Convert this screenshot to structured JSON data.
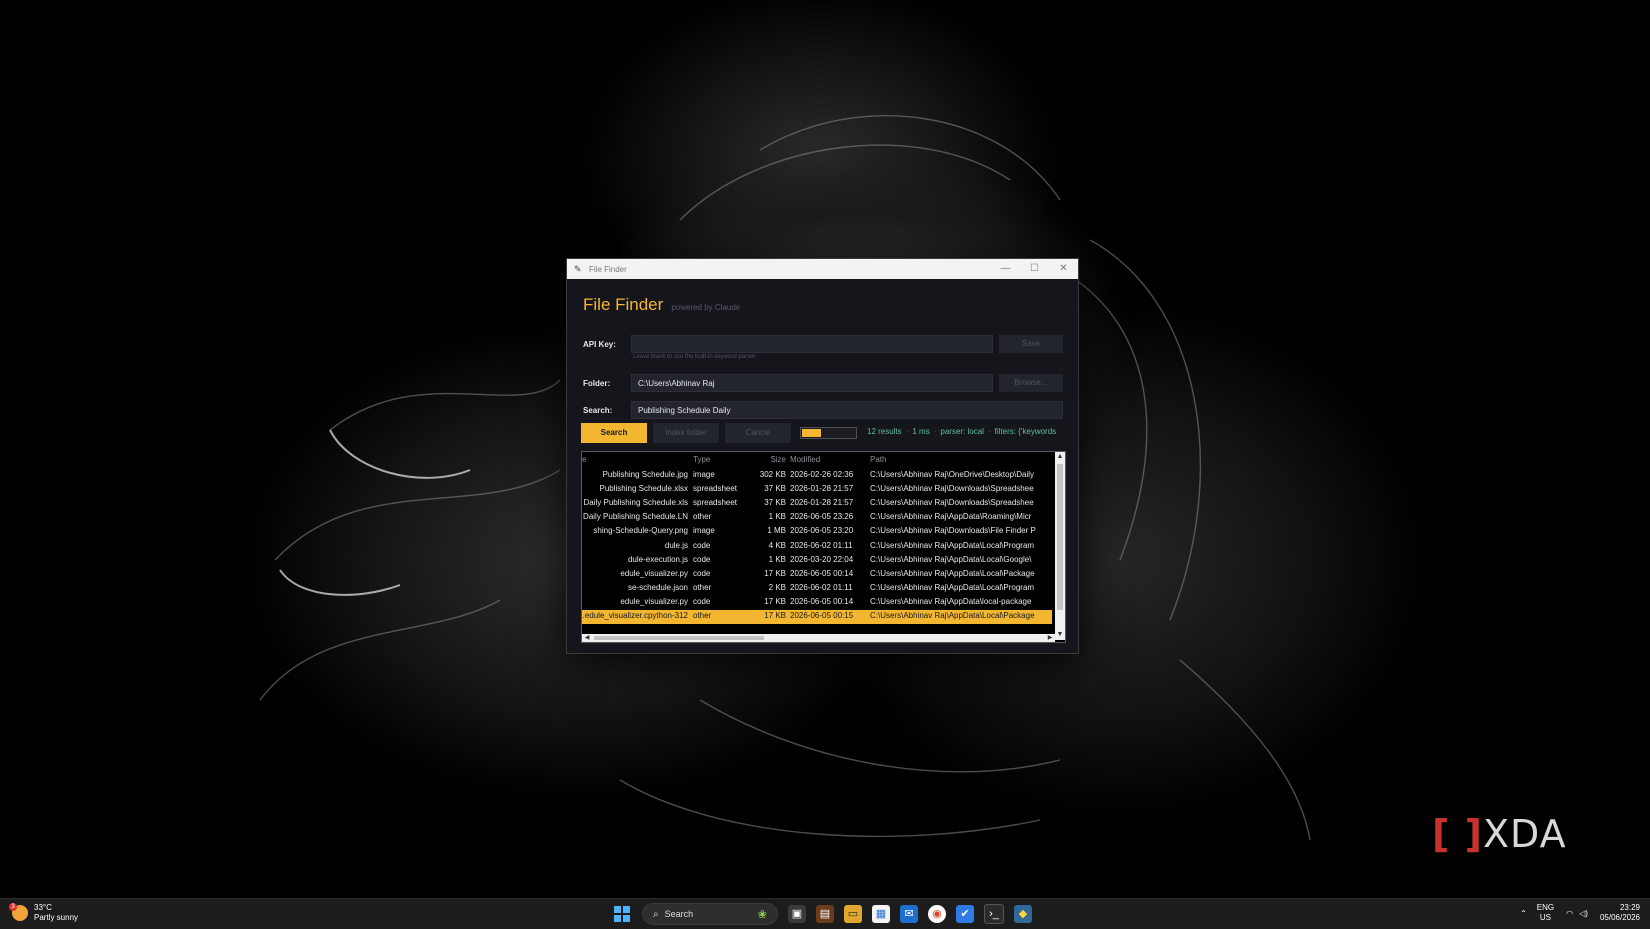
{
  "window": {
    "title": "File Finder",
    "minimize": "—",
    "maximize": "☐",
    "close": "✕"
  },
  "app": {
    "title": "File Finder",
    "subtitle": "powered by Claude"
  },
  "form": {
    "api_key_label": "API Key:",
    "api_key_value": "",
    "api_hint": "Leave blank to use the built-in keyword parser",
    "save_label": "Save",
    "folder_label": "Folder:",
    "folder_value": "C:\\Users\\Abhinav Raj",
    "browse_label": "Browse...",
    "search_label": "Search:",
    "search_value": "Publishing Schedule Daily"
  },
  "actions": {
    "search": "Search",
    "index_folder": "Index folder",
    "cancel": "Cancel",
    "progress": 0.35
  },
  "status": {
    "results": "12 results",
    "time": "1 ms",
    "parser": "parser: local",
    "filters": "filters: {'keywords"
  },
  "table": {
    "columns": {
      "name": "e",
      "type": "Type",
      "size": "Size",
      "modified": "Modified",
      "path": "Path"
    },
    "rows": [
      {
        "name": "Publishing Schedule.jpg",
        "type": "image",
        "size": "302 KB",
        "modified": "2026-02-26 02:36",
        "path": "C:\\Users\\Abhinav Raj\\OneDrive\\Desktop\\Daily"
      },
      {
        "name": "Publishing Schedule.xlsx",
        "type": "spreadsheet",
        "size": "37 KB",
        "modified": "2026-01-28 21:57",
        "path": "C:\\Users\\Abhinav Raj\\Downloads\\Spreadshee"
      },
      {
        "name": "Daily Publishing Schedule.xls",
        "type": "spreadsheet",
        "size": "37 KB",
        "modified": "2026-01-28 21:57",
        "path": "C:\\Users\\Abhinav Raj\\Downloads\\Spreadshee"
      },
      {
        "name": "Daily Publishing Schedule.LN",
        "type": "other",
        "size": "1 KB",
        "modified": "2026-06-05 23:26",
        "path": "C:\\Users\\Abhinav Raj\\AppData\\Roaming\\Micr"
      },
      {
        "name": "shing-Schedule-Query.png",
        "type": "image",
        "size": "1 MB",
        "modified": "2026-06-05 23:20",
        "path": "C:\\Users\\Abhinav Raj\\Downloads\\File Finder P"
      },
      {
        "name": "dule.js",
        "type": "code",
        "size": "4 KB",
        "modified": "2026-06-02 01:11",
        "path": "C:\\Users\\Abhinav Raj\\AppData\\Local\\Program"
      },
      {
        "name": "dule-execution.js",
        "type": "code",
        "size": "1 KB",
        "modified": "2026-03-20 22:04",
        "path": "C:\\Users\\Abhinav Raj\\AppData\\Local\\Google\\"
      },
      {
        "name": "edule_visualizer.py",
        "type": "code",
        "size": "17 KB",
        "modified": "2026-06-05 00:14",
        "path": "C:\\Users\\Abhinav Raj\\AppData\\Local\\Package"
      },
      {
        "name": "se-schedule.json",
        "type": "other",
        "size": "2 KB",
        "modified": "2026-06-02 01:11",
        "path": "C:\\Users\\Abhinav Raj\\AppData\\Local\\Program"
      },
      {
        "name": "edule_visualizer.py",
        "type": "code",
        "size": "17 KB",
        "modified": "2026-06-05 00:14",
        "path": "C:\\Users\\Abhinav Raj\\AppData\\local-package"
      },
      {
        "name": "edule_visualizer.cpython-312.",
        "type": "other",
        "size": "17 KB",
        "modified": "2026-06-05 00:15",
        "path": "C:\\Users\\Abhinav Raj\\AppData\\Local\\Package",
        "selected": true
      }
    ]
  },
  "watermark": {
    "brand": "XDA"
  },
  "taskbar": {
    "temperature": "33°C",
    "weather": "Partly sunny",
    "weather_badge": "3",
    "search_placeholder": "Search",
    "lang_top": "ENG",
    "lang_bottom": "US",
    "time": "23:29",
    "date": "05/06/2026",
    "icons": [
      "task-view-icon",
      "notes-icon",
      "file-explorer-icon",
      "store-icon",
      "outlook-icon",
      "chrome-icon",
      "todo-icon",
      "terminal-icon",
      "python-icon"
    ]
  },
  "colors": {
    "accent": "#f2b630",
    "status_text": "#5fbf9a"
  }
}
